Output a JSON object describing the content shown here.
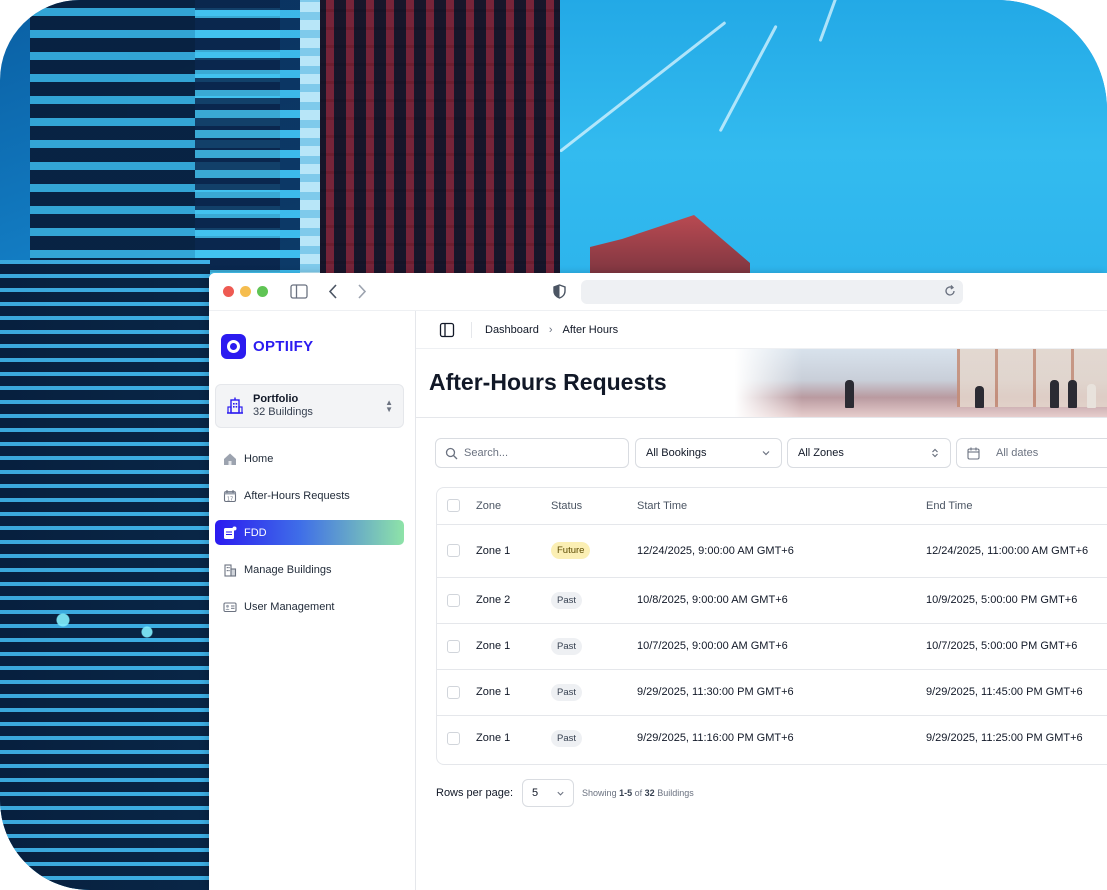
{
  "brand": {
    "name": "OPTIIFY",
    "color": "#2b1bf0"
  },
  "portfolio": {
    "title": "Portfolio",
    "subtitle": "32 Buildings",
    "icon": "building-icon"
  },
  "nav": [
    {
      "label": "Home",
      "icon": "home-icon",
      "active": false
    },
    {
      "label": "After-Hours Requests",
      "icon": "calendar-icon",
      "active": false
    },
    {
      "label": "FDD",
      "icon": "fdd-icon",
      "active": true
    },
    {
      "label": "Manage Buildings",
      "icon": "buildings-icon",
      "active": false
    },
    {
      "label": "User Management",
      "icon": "id-card-icon",
      "active": false
    }
  ],
  "breadcrumb": {
    "first": "Dashboard",
    "current": "After Hours"
  },
  "page": {
    "title": "After-Hours Requests"
  },
  "filters": {
    "search_placeholder": "Search...",
    "bookings": "All Bookings",
    "zones": "All Zones",
    "dates_placeholder": "All dates"
  },
  "table": {
    "headers": {
      "zone": "Zone",
      "status": "Status",
      "start": "Start Time",
      "end": "End Time"
    },
    "rows": [
      {
        "zone": "Zone 1",
        "status": "Future",
        "start": "12/24/2025, 9:00:00 AM GMT+6",
        "end": "12/24/2025, 11:00:00 AM GMT+6"
      },
      {
        "zone": "Zone 2",
        "status": "Past",
        "start": "10/8/2025, 9:00:00 AM GMT+6",
        "end": "10/9/2025, 5:00:00 PM GMT+6"
      },
      {
        "zone": "Zone 1",
        "status": "Past",
        "start": "10/7/2025, 9:00:00 AM GMT+6",
        "end": "10/7/2025, 5:00:00 PM GMT+6"
      },
      {
        "zone": "Zone 1",
        "status": "Past",
        "start": "9/29/2025, 11:30:00 PM GMT+6",
        "end": "9/29/2025, 11:45:00 PM GMT+6"
      },
      {
        "zone": "Zone 1",
        "status": "Past",
        "start": "9/29/2025, 11:16:00 PM GMT+6",
        "end": "9/29/2025, 11:25:00 PM GMT+6"
      }
    ]
  },
  "pagination": {
    "rows_label": "Rows per page:",
    "rows_value": "5",
    "showing_prefix": "Showing",
    "showing_range": "1-5",
    "showing_of": "of",
    "showing_total": "32",
    "showing_suffix": "Buildings"
  },
  "status_colors": {
    "future_bg": "#fbefb4",
    "past_bg": "#eef0f3"
  }
}
